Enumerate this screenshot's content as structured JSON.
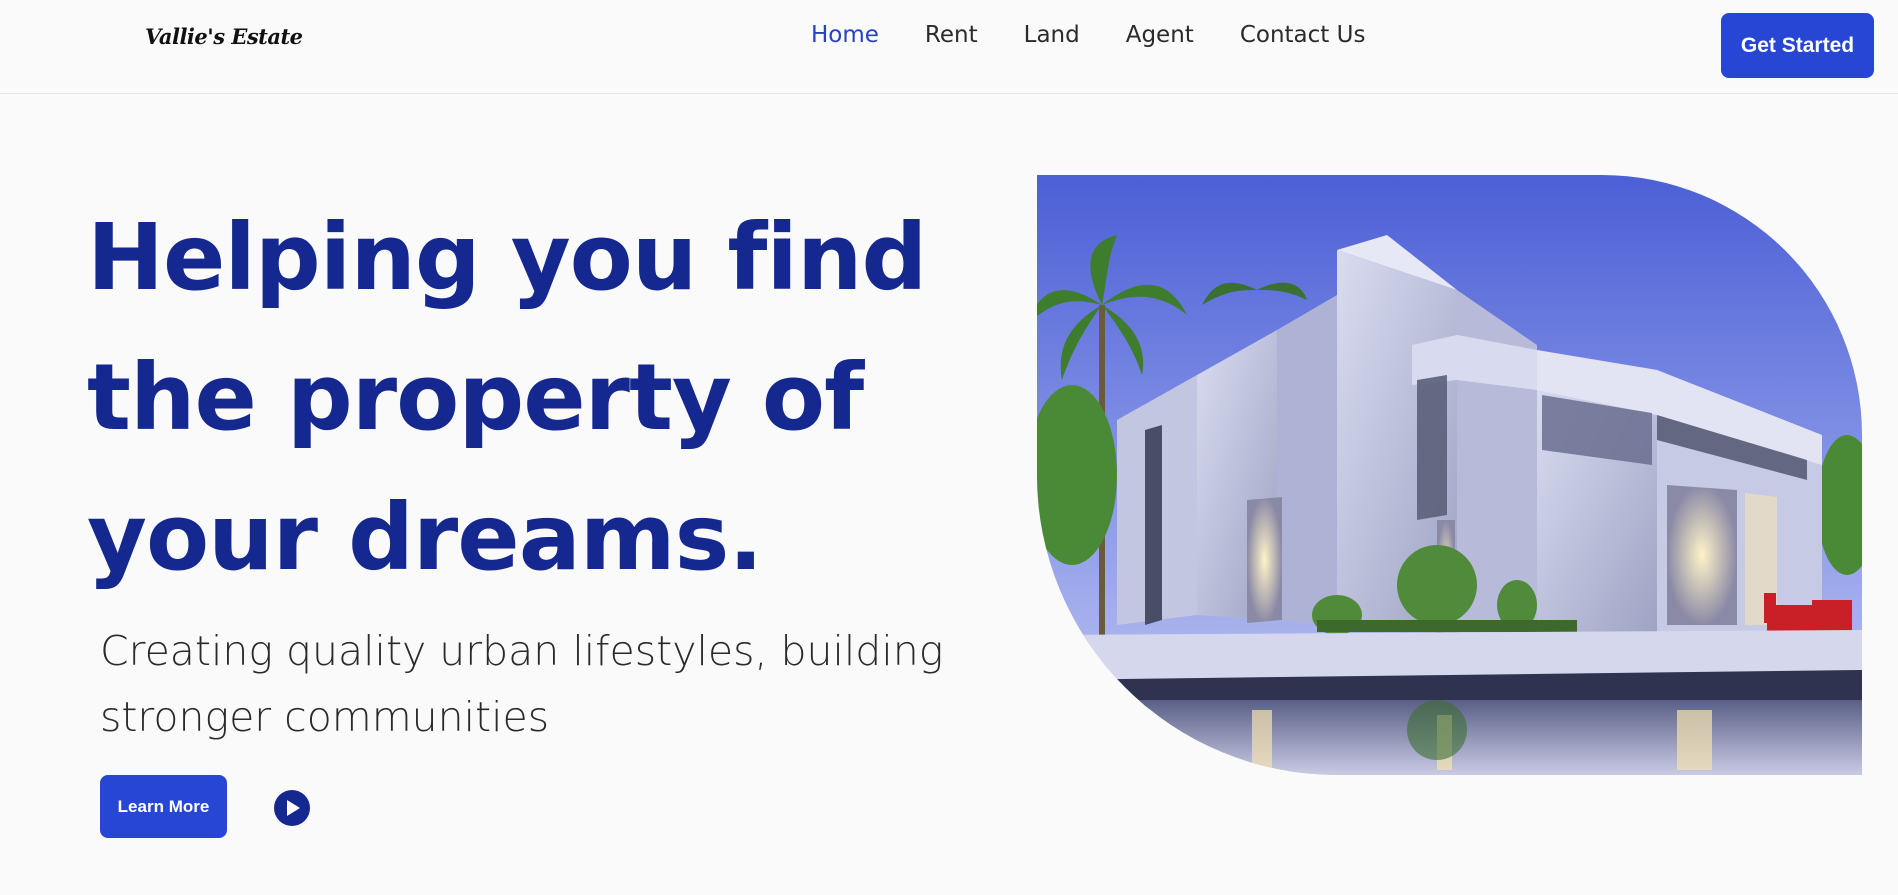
{
  "brand": {
    "name": "Vallie's Estate"
  },
  "nav": {
    "items": [
      {
        "label": "Home",
        "active": true
      },
      {
        "label": "Rent",
        "active": false
      },
      {
        "label": "Land",
        "active": false
      },
      {
        "label": "Agent",
        "active": false
      },
      {
        "label": "Contact Us",
        "active": false
      }
    ],
    "cta_label": "Get Started"
  },
  "hero": {
    "title": "Helping you find the property of your dreams.",
    "subtitle": "Creating quality urban lifestyles, building stronger communities",
    "learn_more_label": "Learn More",
    "play_icon": "play-icon"
  },
  "colors": {
    "accent": "#2846d4",
    "heading": "#15288f",
    "background": "#fafafa"
  }
}
